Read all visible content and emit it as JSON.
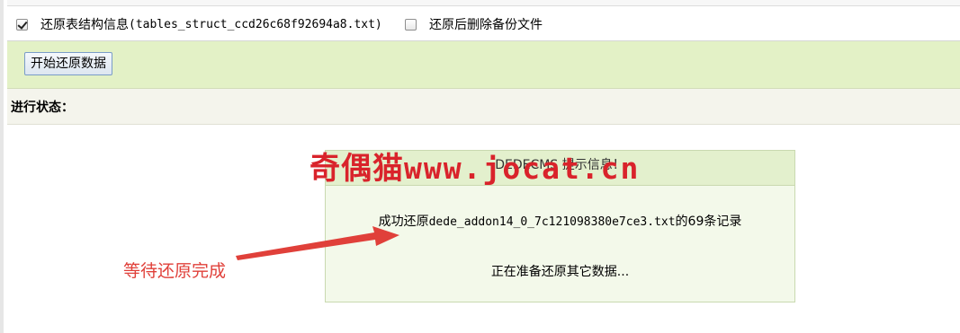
{
  "options": {
    "restore_struct_checked": true,
    "restore_struct_label": "还原表结构信息",
    "restore_struct_file": "(tables_struct_ccd26c68f92694a8.txt)",
    "delete_backup_checked": false,
    "delete_backup_label": "还原后删除备份文件"
  },
  "actions": {
    "start_button_label": "开始还原数据"
  },
  "status": {
    "label": "进行状态："
  },
  "message_box": {
    "header": "DEDECMS 提示信息！",
    "line1_prefix": "成功还原",
    "line1_file": "dede_addon14_0_7c121098380e7ce3.txt",
    "line1_suffix": "的69条记录",
    "line2": "正在准备还原其它数据..."
  },
  "watermark": {
    "brand_cn": "奇偶猫",
    "url": "www.jocat.cn"
  },
  "annotation": {
    "text": "等待还原完成",
    "color": "#e0403a"
  }
}
